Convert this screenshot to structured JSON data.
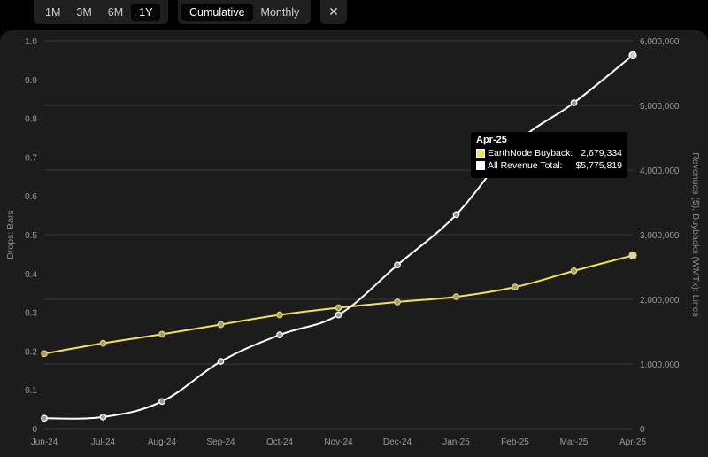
{
  "toolbar": {
    "ranges": [
      "1M",
      "3M",
      "6M",
      "1Y"
    ],
    "active_range": "1Y",
    "modes": [
      "Cumulative",
      "Monthly"
    ],
    "active_mode": "Cumulative",
    "close_label": "✕"
  },
  "tooltip": {
    "title": "Apr-25",
    "rows": [
      {
        "label": "EarthNode Buyback:",
        "value": "2,679,334",
        "color": "#f2e25a"
      },
      {
        "label": "All Revenue Total:",
        "value": "$5,775,819",
        "color": "#ffffff"
      }
    ]
  },
  "chart_data": {
    "type": "line",
    "categories": [
      "Jun-24",
      "Jul-24",
      "Aug-24",
      "Sep-24",
      "Oct-24",
      "Nov-24",
      "Dec-24",
      "Jan-25",
      "Feb-25",
      "Mar-25",
      "Apr-25"
    ],
    "y_left": {
      "label": "Drops: Bars",
      "range": [
        0,
        1.0
      ],
      "ticks": [
        "0",
        "0.1",
        "0.2",
        "0.3",
        "0.4",
        "0.5",
        "0.6",
        "0.7",
        "0.8",
        "0.9",
        "1.0"
      ]
    },
    "y_right": {
      "label": "Revenues ($), Buybacks (WMTx): Lines",
      "range": [
        0,
        6000000
      ],
      "ticks": [
        "0",
        "1,000,000",
        "2,000,000",
        "3,000,000",
        "4,000,000",
        "5,000,000",
        "6,000,000"
      ]
    },
    "grid": true,
    "series": [
      {
        "name": "EarthNode Buyback",
        "color": "#f2e25a",
        "axis": "right",
        "values": [
          1160000,
          1320000,
          1460000,
          1610000,
          1760000,
          1870000,
          1960000,
          2040000,
          2190000,
          2440000,
          2679334
        ]
      },
      {
        "name": "All Revenue Total",
        "color": "#ffffff",
        "axis": "right",
        "values": [
          160000,
          180000,
          420000,
          1040000,
          1450000,
          1760000,
          2530000,
          3310000,
          4400000,
          5040000,
          5775819
        ]
      }
    ]
  }
}
